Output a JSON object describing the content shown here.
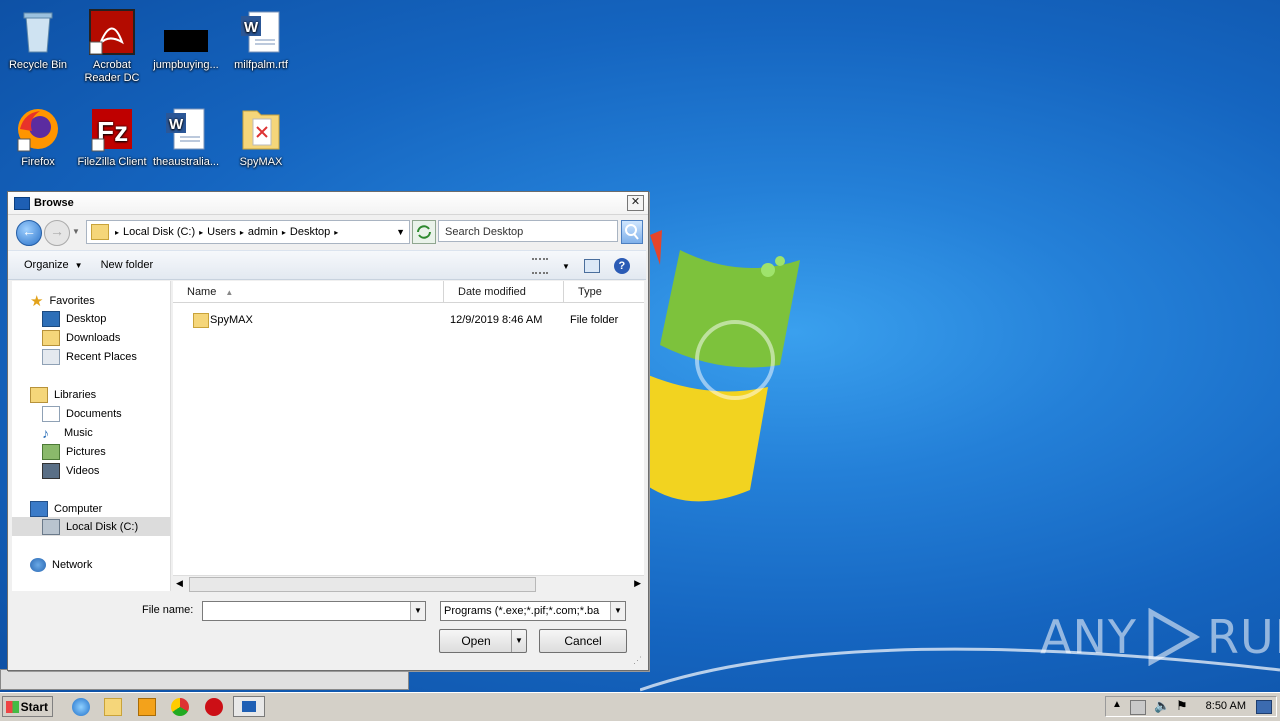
{
  "desktop": {
    "icons": [
      {
        "label": "Recycle Bin"
      },
      {
        "label": "Acrobat Reader DC"
      },
      {
        "label": "jumpbuying..."
      },
      {
        "label": "milfpalm.rtf"
      },
      {
        "label": "Firefox"
      },
      {
        "label": "FileZilla Client"
      },
      {
        "label": "theaustralia..."
      },
      {
        "label": "SpyMAX"
      }
    ],
    "watermark": {
      "left": "ANY",
      "right": "RUN"
    }
  },
  "dialog": {
    "title": "Browse",
    "close_glyph": "✕",
    "breadcrumb": [
      "Local Disk (C:)",
      "Users",
      "admin",
      "Desktop"
    ],
    "search_placeholder": "Search Desktop",
    "toolbar": {
      "organize": "Organize",
      "new_folder": "New folder"
    },
    "nav": {
      "favorites": "Favorites",
      "desktop": "Desktop",
      "downloads": "Downloads",
      "recent": "Recent Places",
      "libraries": "Libraries",
      "documents": "Documents",
      "music": "Music",
      "pictures": "Pictures",
      "videos": "Videos",
      "computer": "Computer",
      "local_disk": "Local Disk (C:)",
      "network": "Network"
    },
    "columns": {
      "name": "Name",
      "date": "Date modified",
      "type": "Type"
    },
    "files": [
      {
        "name": "SpyMAX",
        "date": "12/9/2019 8:46 AM",
        "type": "File folder"
      }
    ],
    "file_name_label": "File name:",
    "file_name_value": "",
    "filter_value": "Programs (*.exe;*.pif;*.com;*.ba",
    "open_label": "Open",
    "cancel_label": "Cancel"
  },
  "taskbar": {
    "start_label": "Start",
    "clock": "8:50 AM"
  }
}
